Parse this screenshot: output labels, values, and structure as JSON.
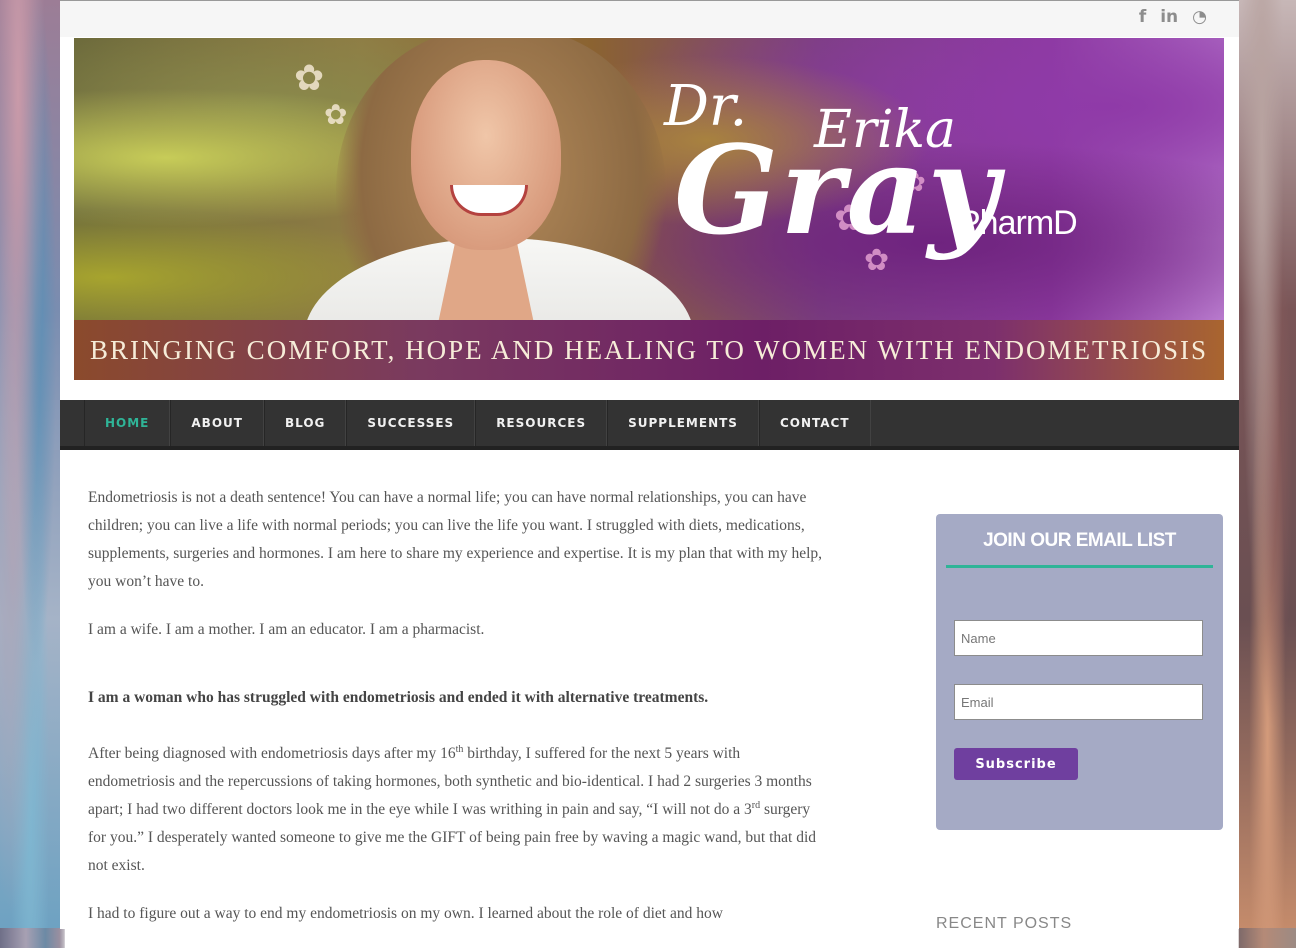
{
  "social": {
    "facebook": "f",
    "linkedin": "in",
    "rss": "◔"
  },
  "banner": {
    "dr": "Dr.",
    "first_name": "Erika",
    "last_name": "Gray",
    "credential": "PharmD",
    "tagline": "BRINGING COMFORT, HOPE AND HEALING TO WOMEN WITH ENDOMETRIOSIS"
  },
  "nav": {
    "items": [
      {
        "label": "HOME"
      },
      {
        "label": "ABOUT"
      },
      {
        "label": "BLOG"
      },
      {
        "label": "SUCCESSES"
      },
      {
        "label": "RESOURCES"
      },
      {
        "label": "SUPPLEMENTS"
      },
      {
        "label": "CONTACT"
      }
    ]
  },
  "content": {
    "p1": "Endometriosis is not a death sentence!  You can have a normal life; you can have normal relationships, you can have children; you can live a life with normal periods; you can live the life you want.   I struggled with diets, medications, supplements, surgeries and hormones.  I am here to share my experience and expertise.  It is my plan that with my help, you won’t have to.",
    "p2": "I am a wife. I am a mother. I am an educator. I am a pharmacist.",
    "p3": "I am a woman who has struggled with endometriosis and ended it with alternative treatments.",
    "p4a": "After being diagnosed with endometriosis days after my 16",
    "p4sup1": "th",
    "p4b": " birthday, I suffered for the next 5 years with endometriosis and the repercussions of taking hormones, both synthetic and bio-identical.  I had 2 surgeries 3 months apart; I had two different doctors look me in the eye while I was writhing in pain and say, “I will not do a 3",
    "p4sup2": "rd",
    "p4c": " surgery for you.” I desperately wanted someone to give me the GIFT of being pain free by waving a magic wand, but that did not exist.",
    "p5": "I had to figure out a way to end my endometriosis on my own.  I learned about the role of diet and how"
  },
  "sidebar": {
    "email_title": "JOIN OUR EMAIL LIST",
    "name_placeholder": "Name",
    "email_placeholder": "Email",
    "subscribe_label": "Subscribe",
    "recent_posts": "RECENT POSTS"
  },
  "colors": {
    "accent": "#2fb497",
    "nav_bg": "#333333",
    "widget_bg": "#a5aac5",
    "button": "#6f3f9f"
  }
}
